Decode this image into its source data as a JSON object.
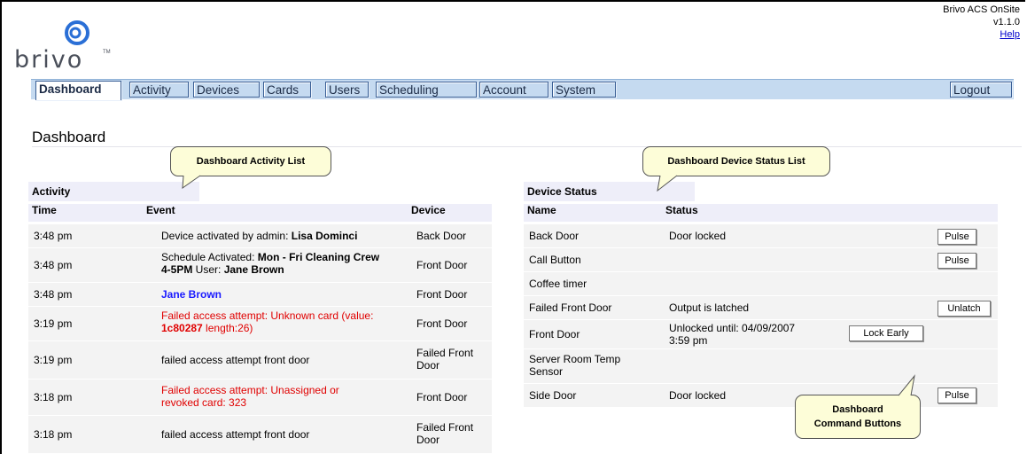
{
  "app": {
    "product": "Brivo ACS OnSite",
    "version": "v1.1.0",
    "help_label": "Help",
    "logo_text": "brivo",
    "logo_tm": "TM"
  },
  "nav": {
    "tabs": [
      {
        "label": "Dashboard"
      },
      {
        "label": "Activity"
      },
      {
        "label": "Devices"
      },
      {
        "label": "Cards"
      },
      {
        "label": "Users"
      },
      {
        "label": "Scheduling"
      },
      {
        "label": "Account"
      },
      {
        "label": "System"
      }
    ],
    "active": "Dashboard",
    "logout_label": "Logout"
  },
  "page_title": "Dashboard",
  "callouts": {
    "activity": "Dashboard Activity List",
    "device_status": "Dashboard Device Status List",
    "command_buttons_line1": "Dashboard",
    "command_buttons_line2": "Command Buttons"
  },
  "activity": {
    "title": "Activity",
    "columns": [
      "Time",
      "Event",
      "Device"
    ],
    "rows": [
      {
        "time": "3:48 pm",
        "event_parts": [
          "Device activated by admin: ",
          "Lisa Dominci"
        ],
        "device": "Back Door"
      },
      {
        "time": "3:48 pm",
        "event_parts": [
          "Schedule Activated: ",
          "Mon - Fri Cleaning Crew 4-5PM",
          " User: ",
          "Jane Brown"
        ],
        "device": "Front Door"
      },
      {
        "time": "3:48 pm",
        "event": "Jane Brown",
        "device": "Front Door"
      },
      {
        "time": "3:19 pm",
        "event_parts": [
          "Failed access attempt: Unknown card (value: ",
          "1c80287",
          " length:26)"
        ],
        "device": "Front Door"
      },
      {
        "time": "3:19 pm",
        "event": "failed access attempt front door",
        "device_line1": "Failed Front",
        "device_line2": "Door"
      },
      {
        "time": "3:18 pm",
        "event_line1": "Failed access attempt: Unassigned or",
        "event_line2": "revoked card: 323",
        "device": "Front Door"
      },
      {
        "time": "3:18 pm",
        "event": "failed access attempt front door",
        "device_line1": "Failed Front",
        "device_line2": "Door"
      }
    ]
  },
  "device_status": {
    "title": "Device Status",
    "columns": [
      "Name",
      "Status"
    ],
    "rows": [
      {
        "name": "Back Door",
        "status": "Door locked",
        "button": "Pulse"
      },
      {
        "name": "Call Button",
        "status": "",
        "button": "Pulse"
      },
      {
        "name": "Coffee timer",
        "status": ""
      },
      {
        "name": "Failed Front Door",
        "status": "Output is latched",
        "button": "Unlatch"
      },
      {
        "name": "Front Door",
        "status_line1": "Unlocked until: 04/09/2007",
        "status_line2": "3:59 pm",
        "button": "Lock Early"
      },
      {
        "name_line1": "Server Room Temp",
        "name_line2": "Sensor",
        "status": ""
      },
      {
        "name": "Side Door",
        "status": "Door locked",
        "button": "Pulse"
      }
    ]
  },
  "colors": {
    "nav_bg": "#c5daf0",
    "panel_header_bg": "#eeeef9",
    "row_bg": "#f3f3f3",
    "error_red": "#e00000",
    "link_blue": "#1a1aff",
    "callout_bg": "#fdfdd8",
    "logo_blue": "#2a6fd6"
  }
}
